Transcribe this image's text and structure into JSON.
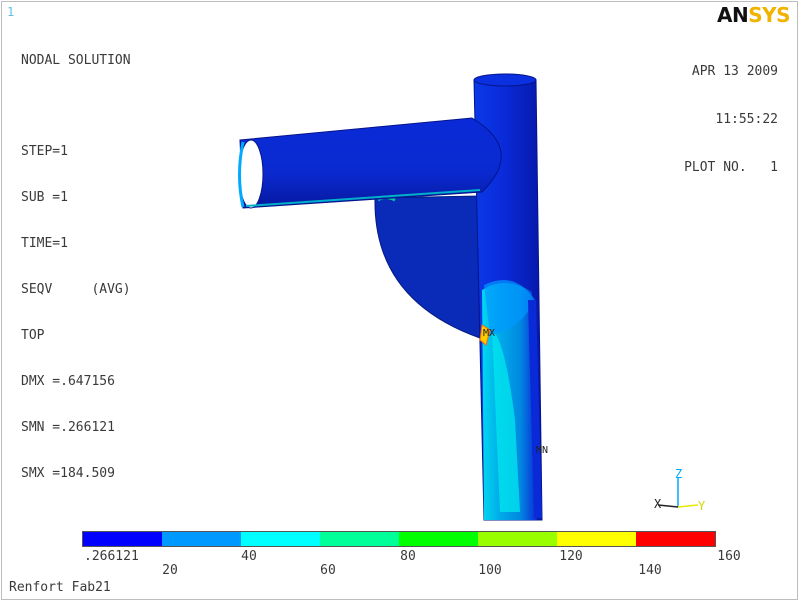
{
  "window_number": "1",
  "header": {
    "lines": [
      "NODAL SOLUTION",
      "",
      "STEP=1",
      "SUB =1",
      "TIME=1",
      "SEQV     (AVG)",
      "TOP",
      "DMX =.647156",
      "SMN =.266121",
      "SMX =184.509"
    ],
    "date": "APR 13 2009",
    "time": "11:55:22",
    "plot_no": "PLOT NO.   1"
  },
  "logo": {
    "part_a": "AN",
    "part_b": "SYS"
  },
  "markers": {
    "max": "MX",
    "min": "MN"
  },
  "legend": {
    "colors": [
      "#0000ff",
      "#0099ff",
      "#00ffff",
      "#00ff99",
      "#00ff00",
      "#99ff00",
      "#ffff00",
      "#ff0000"
    ],
    "labels_bottom": [
      ".266121",
      "40",
      "80",
      "120",
      "160"
    ],
    "labels_top": [
      "20",
      "60",
      "100",
      "140"
    ]
  },
  "triad": {
    "x": "X",
    "y": "Y",
    "z": "Z"
  },
  "footer": "Renfort Fab21",
  "colors": {
    "frame": "#bdbdbd",
    "accent_blue": "#0a2ad8",
    "logo_yellow": "#f0b400"
  }
}
